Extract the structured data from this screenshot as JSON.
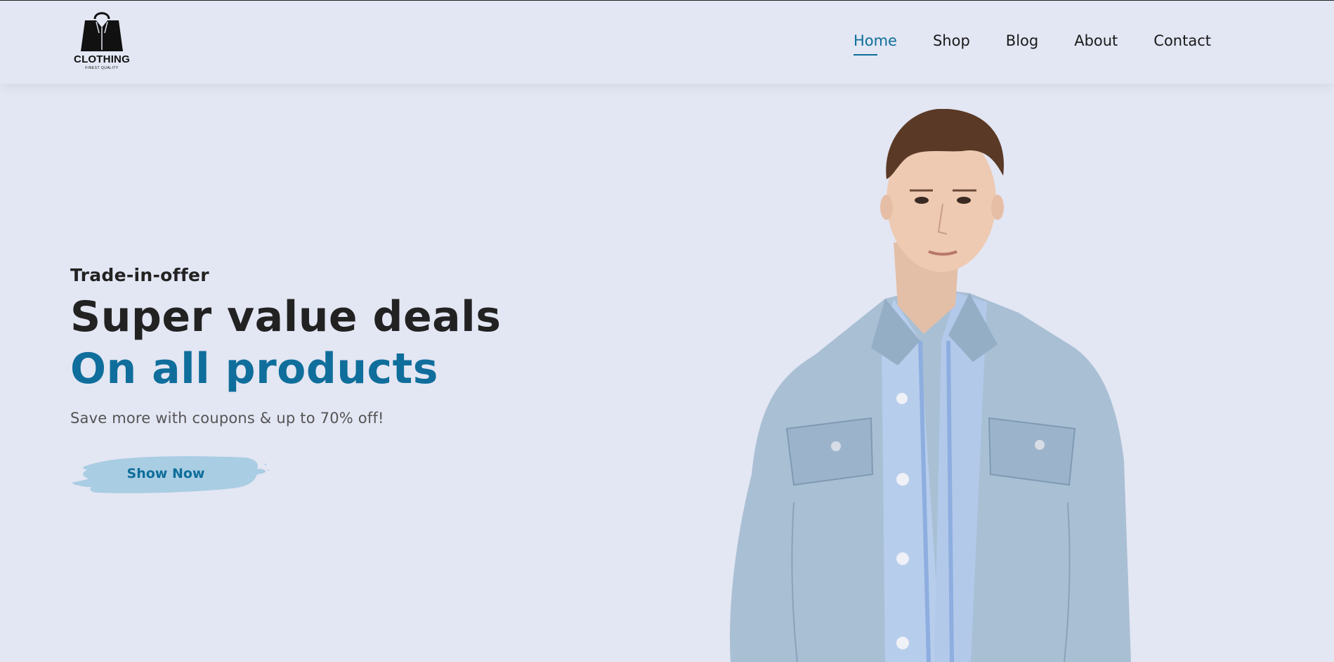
{
  "brand": {
    "name": "CLOTHING",
    "tagline": "FINEST QUALITY",
    "logo_icon": "shopping-bag-shirt-icon"
  },
  "nav": {
    "items": [
      {
        "label": "Home",
        "active": true
      },
      {
        "label": "Shop",
        "active": false
      },
      {
        "label": "Blog",
        "active": false
      },
      {
        "label": "About",
        "active": false
      },
      {
        "label": "Contact",
        "active": false
      }
    ]
  },
  "hero": {
    "eyebrow": "Trade-in-offer",
    "headline": "Super value deals",
    "headline_accent": "On all products",
    "subtext": "Save more with coupons & up to 70% off!",
    "cta_label": "Show Now",
    "image_alt": "model-wearing-denim-jacket"
  },
  "colors": {
    "background": "#e3e6f3",
    "accent": "#0f6e9b",
    "button_brush": "#a9cde3",
    "text_dark": "#222222"
  }
}
